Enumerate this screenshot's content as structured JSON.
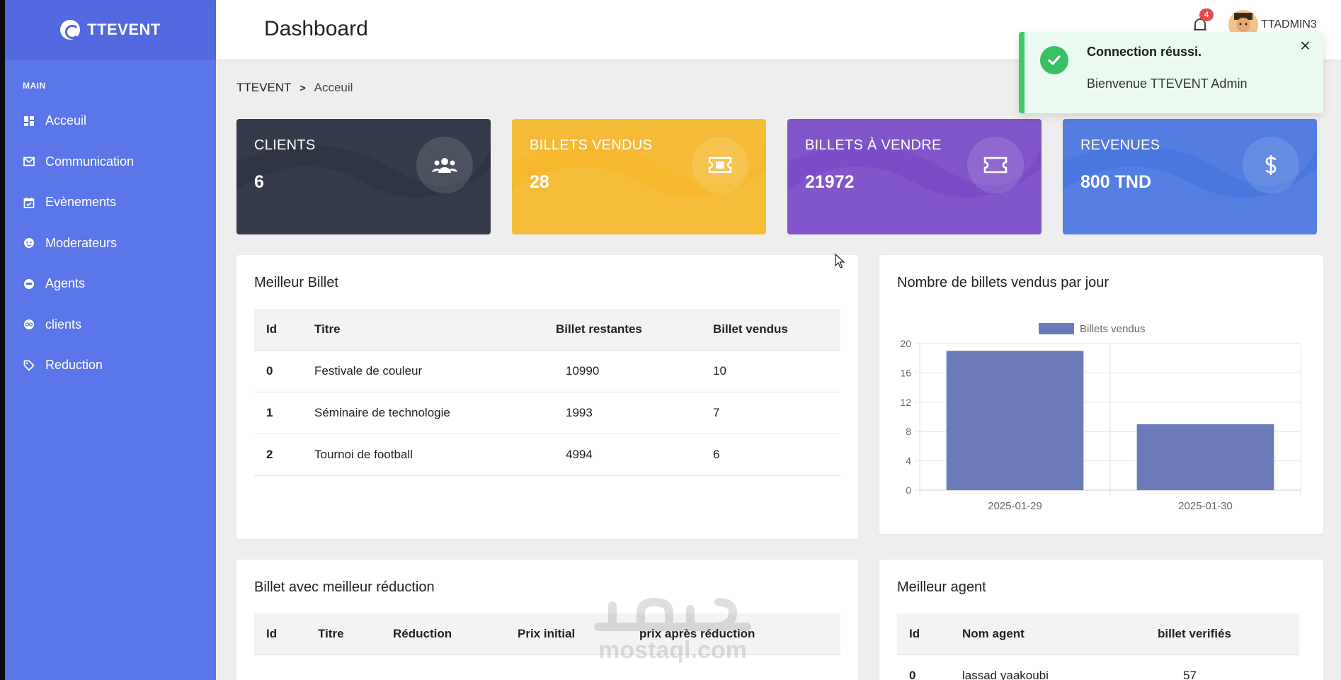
{
  "sidebar": {
    "brand": "TTEVENT",
    "section": "MAIN",
    "items": [
      {
        "label": "Acceuil",
        "icon": "dashboard-icon"
      },
      {
        "label": "Communication",
        "icon": "mail-icon"
      },
      {
        "label": "Evènements",
        "icon": "calendar-icon"
      },
      {
        "label": "Moderateurs",
        "icon": "face-icon"
      },
      {
        "label": "Agents",
        "icon": "agent-icon"
      },
      {
        "label": "clients",
        "icon": "client-icon"
      },
      {
        "label": "Reduction",
        "icon": "tag-icon"
      }
    ]
  },
  "header": {
    "title": "Dashboard",
    "notification_count": "4",
    "user": "TTADMIN3"
  },
  "toast": {
    "title": "Connection réussi.",
    "message": "Bienvenue TTEVENT Admin",
    "close": "×"
  },
  "breadcrumb": {
    "root": "TTEVENT",
    "current": "Acceuil"
  },
  "stats": [
    {
      "label": "CLIENTS",
      "value": "6",
      "icon": "users-icon",
      "color": "#2f3545"
    },
    {
      "label": "BILLETS VENDUS",
      "value": "28",
      "icon": "ticket-icon",
      "color": "#f5b82e"
    },
    {
      "label": "BILLETS À VENDRE",
      "value": "21972",
      "icon": "ticket-outline-icon",
      "color": "#7b4bc8"
    },
    {
      "label": "REVENUES",
      "value": "800 TND",
      "icon": "dollar-icon",
      "color": "#4a76e0"
    }
  ],
  "best_ticket": {
    "title": "Meilleur Billet",
    "headers": [
      "Id",
      "Titre",
      "Billet restantes",
      "Billet vendus"
    ],
    "rows": [
      [
        "0",
        "Festivale de couleur",
        "10990",
        "10"
      ],
      [
        "1",
        "Séminaire de technologie",
        "1993",
        "7"
      ],
      [
        "2",
        "Tournoi de football",
        "4994",
        "6"
      ]
    ]
  },
  "sales_chart": {
    "title": "Nombre de billets vendus par jour"
  },
  "chart_data": {
    "type": "bar",
    "categories": [
      "2025-01-29",
      "2025-01-30"
    ],
    "series": [
      {
        "name": "Billets vendus",
        "values": [
          19,
          9
        ]
      }
    ],
    "yticks": [
      0,
      4,
      8,
      12,
      16,
      20
    ],
    "ylim": [
      0,
      20
    ],
    "title": "Nombre de billets vendus par jour",
    "bar_color": "#6b7bba",
    "legend": "top-center",
    "grid": true
  },
  "best_reduction": {
    "title": "Billet avec meilleur réduction",
    "headers": [
      "Id",
      "Titre",
      "Réduction",
      "Prix initial",
      "prix après réduction"
    ]
  },
  "best_agent": {
    "title": "Meilleur agent",
    "headers": [
      "Id",
      "Nom agent",
      "billet verifiés"
    ],
    "rows": [
      [
        "0",
        "lassad yaakoubi",
        "57"
      ]
    ]
  },
  "watermark": "mostaql.com"
}
